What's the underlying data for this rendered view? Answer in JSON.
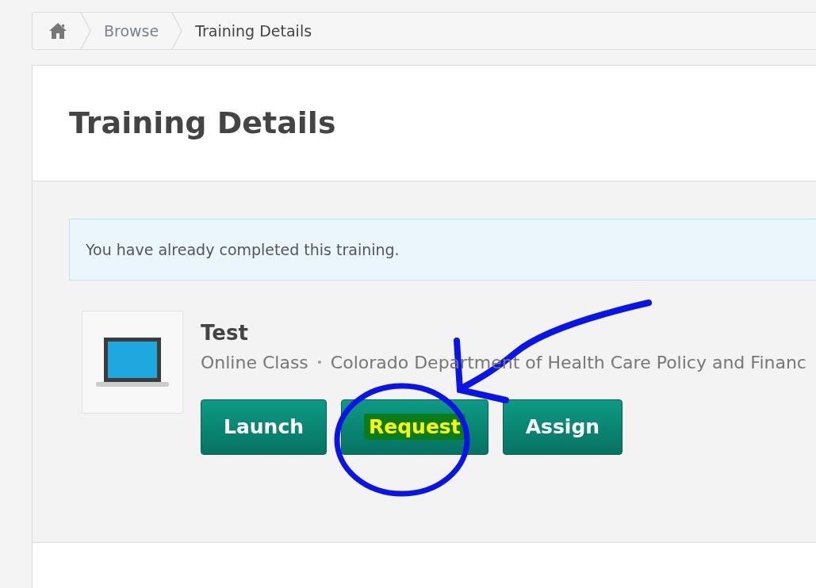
{
  "breadcrumb": [
    {
      "label": "Browse"
    },
    {
      "label": "Training Details"
    }
  ],
  "page_title": "Training Details",
  "alert": "You have already completed this training.",
  "training": {
    "title": "Test",
    "type": "Online Class",
    "provider": "Colorado Department of Health Care Policy and Financ"
  },
  "buttons": [
    {
      "label": "Launch",
      "highlighted": false
    },
    {
      "label": "Request",
      "highlighted": true
    },
    {
      "label": "Assign",
      "highlighted": false
    }
  ]
}
